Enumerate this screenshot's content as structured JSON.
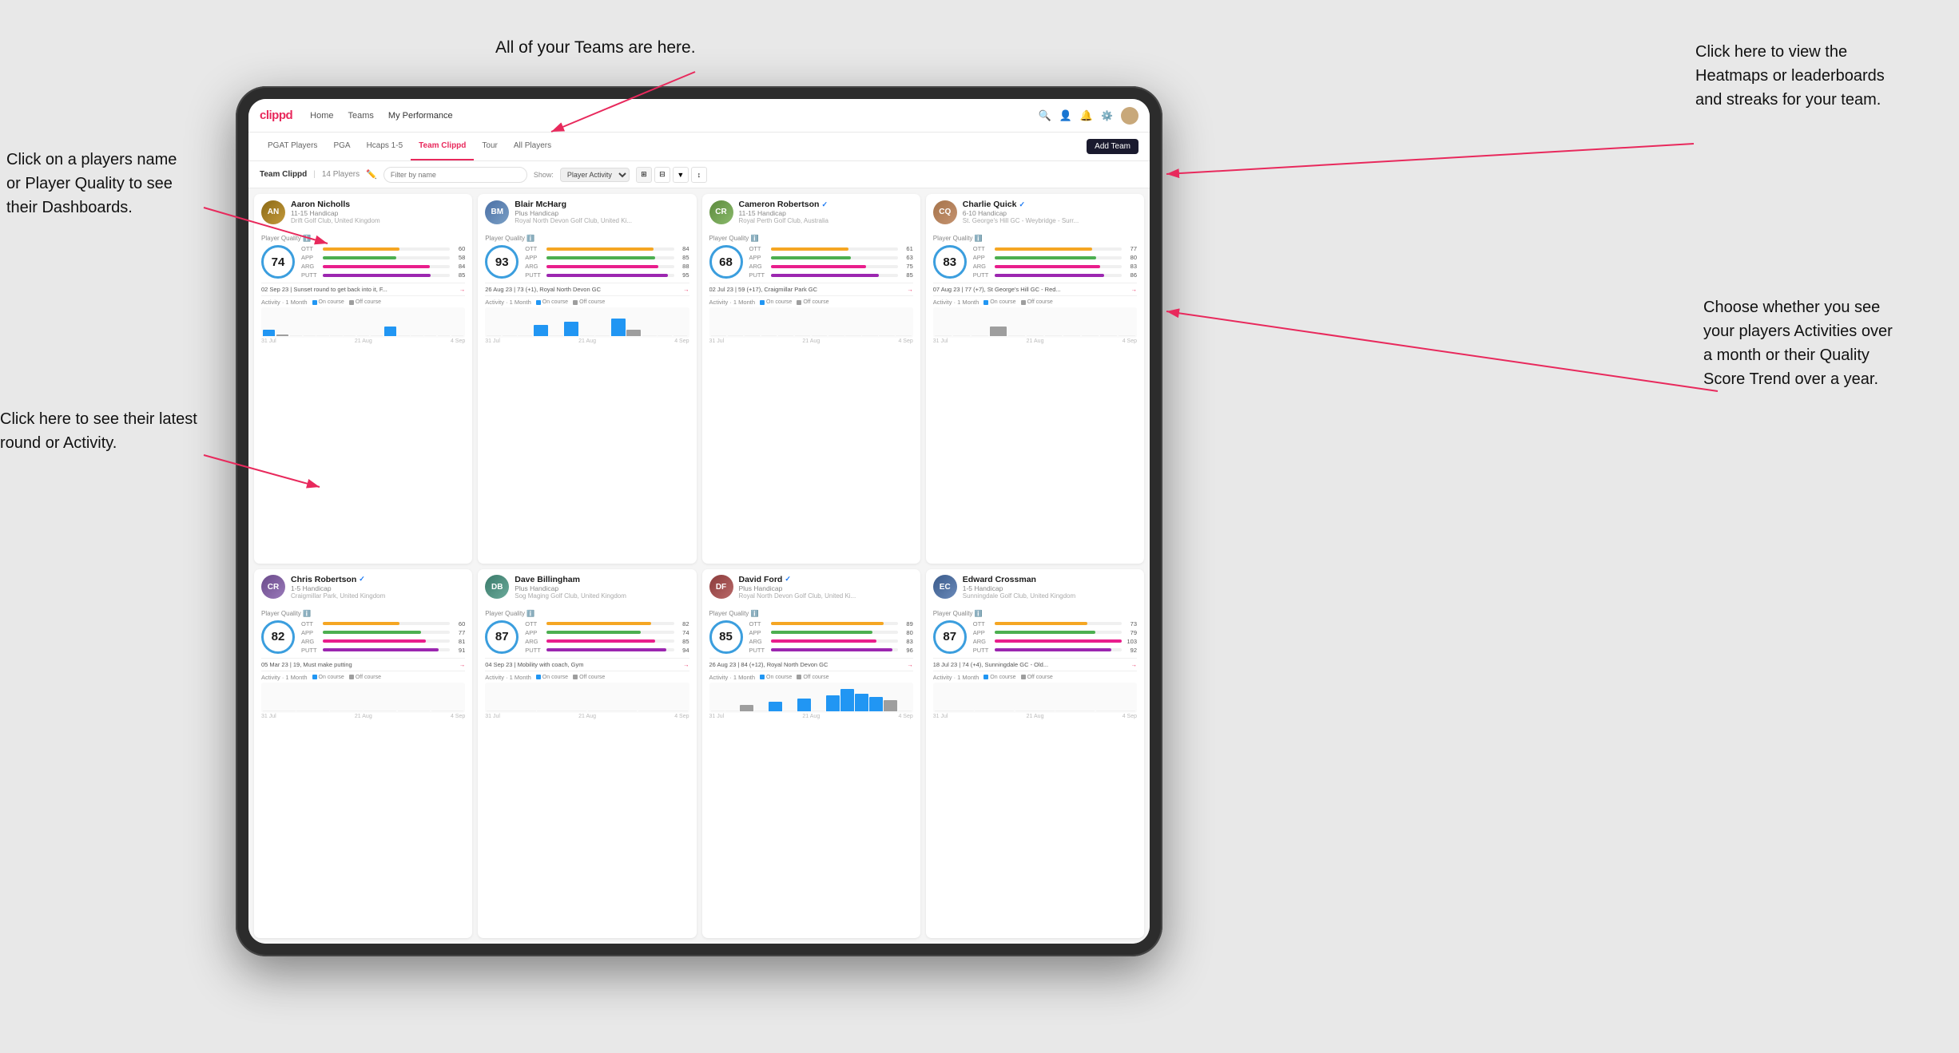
{
  "annotations": {
    "top_arrow": "All of your Teams are here.",
    "right_top": "Click here to view the\nHeatmaps or leaderboards\nand streaks for your team.",
    "left_top": "Click on a players name\nor Player Quality to see\ntheir Dashboards.",
    "left_bottom": "Click here to see their latest\nround or Activity.",
    "right_bottom": "Choose whether you see\nyour players Activities over\na month or their Quality\nScore Trend over a year."
  },
  "navbar": {
    "logo": "clippd",
    "links": [
      "Home",
      "Teams",
      "My Performance"
    ],
    "active_link": "My Performance"
  },
  "subnav": {
    "tabs": [
      "PGAT Players",
      "PGA",
      "Hcaps 1-5",
      "Team Clippd",
      "Tour",
      "All Players"
    ],
    "active_tab": "Team Clippd",
    "add_team": "Add Team"
  },
  "team_header": {
    "title": "Team Clippd",
    "count": "14 Players",
    "filter_placeholder": "Filter by name",
    "show_label": "Show:",
    "show_option": "Player Activity"
  },
  "players": [
    {
      "id": 1,
      "name": "Aaron Nicholls",
      "handicap": "11-15 Handicap",
      "club": "Drift Golf Club, United Kingdom",
      "quality": 74,
      "ott": {
        "value": 60,
        "pct": 60
      },
      "app": {
        "value": 58,
        "pct": 58
      },
      "arg": {
        "value": 84,
        "pct": 84
      },
      "putt": {
        "value": 85,
        "pct": 85
      },
      "latest_round": "02 Sep 23 | Sunset round to get back into it, F...",
      "activity_bars": [
        0,
        0,
        0,
        0,
        0,
        0,
        0,
        0,
        0,
        0,
        0,
        0,
        0,
        0,
        2,
        0,
        3,
        0,
        0,
        0,
        0,
        0,
        0,
        0,
        0,
        0,
        0,
        0
      ],
      "dates": [
        "31 Jul",
        "21 Aug",
        "4 Sep"
      ],
      "verified": false
    },
    {
      "id": 2,
      "name": "Blair McHarg",
      "handicap": "Plus Handicap",
      "club": "Royal North Devon Golf Club, United Ki...",
      "quality": 93,
      "ott": {
        "value": 84,
        "pct": 84
      },
      "app": {
        "value": 85,
        "pct": 85
      },
      "arg": {
        "value": 88,
        "pct": 88
      },
      "putt": {
        "value": 95,
        "pct": 95
      },
      "latest_round": "26 Aug 23 | 73 (+1), Royal North Devon GC",
      "activity_bars": [
        0,
        0,
        0,
        0,
        0,
        0,
        0,
        3,
        0,
        0,
        0,
        4,
        0,
        0,
        5,
        0,
        0,
        3,
        0,
        0,
        0,
        4,
        0,
        0,
        0,
        0,
        0,
        0
      ],
      "dates": [
        "31 Jul",
        "21 Aug",
        "4 Sep"
      ],
      "verified": false
    },
    {
      "id": 3,
      "name": "Cameron Robertson",
      "handicap": "11-15 Handicap",
      "club": "Royal Perth Golf Club, Australia",
      "quality": 68,
      "ott": {
        "value": 61,
        "pct": 61
      },
      "app": {
        "value": 63,
        "pct": 63
      },
      "arg": {
        "value": 75,
        "pct": 75
      },
      "putt": {
        "value": 85,
        "pct": 85
      },
      "latest_round": "02 Jul 23 | 59 (+17), Craigmillar Park GC",
      "activity_bars": [
        0,
        0,
        0,
        0,
        0,
        0,
        0,
        0,
        0,
        0,
        0,
        0,
        0,
        0,
        0,
        0,
        0,
        0,
        0,
        0,
        0,
        0,
        0,
        0,
        0,
        0,
        0,
        0
      ],
      "dates": [
        "31 Jul",
        "21 Aug",
        "4 Sep"
      ],
      "verified": true
    },
    {
      "id": 4,
      "name": "Charlie Quick",
      "handicap": "6-10 Handicap",
      "club": "St. George's Hill GC - Weybridge - Surr...",
      "quality": 83,
      "ott": {
        "value": 77,
        "pct": 77
      },
      "app": {
        "value": 80,
        "pct": 80
      },
      "arg": {
        "value": 83,
        "pct": 83
      },
      "putt": {
        "value": 86,
        "pct": 86
      },
      "latest_round": "07 Aug 23 | 77 (+7), St George's Hill GC - Red...",
      "activity_bars": [
        0,
        0,
        0,
        0,
        0,
        0,
        0,
        0,
        0,
        0,
        0,
        3,
        0,
        0,
        0,
        0,
        0,
        0,
        0,
        0,
        0,
        0,
        0,
        0,
        0,
        0,
        0,
        0
      ],
      "dates": [
        "31 Jul",
        "21 Aug",
        "4 Sep"
      ],
      "verified": true
    },
    {
      "id": 5,
      "name": "Chris Robertson",
      "handicap": "1-5 Handicap",
      "club": "Craigmillar Park, United Kingdom",
      "quality": 82,
      "ott": {
        "value": 60,
        "pct": 60
      },
      "app": {
        "value": 77,
        "pct": 77
      },
      "arg": {
        "value": 81,
        "pct": 81
      },
      "putt": {
        "value": 91,
        "pct": 91
      },
      "latest_round": "05 Mar 23 | 19, Must make putting",
      "activity_bars": [
        0,
        0,
        0,
        0,
        0,
        0,
        0,
        0,
        0,
        0,
        0,
        0,
        0,
        0,
        0,
        0,
        0,
        0,
        0,
        0,
        0,
        0,
        0,
        0,
        0,
        0,
        0,
        0
      ],
      "dates": [
        "31 Jul",
        "21 Aug",
        "4 Sep"
      ],
      "verified": true
    },
    {
      "id": 6,
      "name": "Dave Billingham",
      "handicap": "Plus Handicap",
      "club": "Sog Maging Golf Club, United Kingdom",
      "quality": 87,
      "ott": {
        "value": 82,
        "pct": 82
      },
      "app": {
        "value": 74,
        "pct": 74
      },
      "arg": {
        "value": 85,
        "pct": 85
      },
      "putt": {
        "value": 94,
        "pct": 94
      },
      "latest_round": "04 Sep 23 | Mobility with coach, Gym",
      "activity_bars": [
        0,
        0,
        0,
        0,
        0,
        0,
        0,
        0,
        0,
        0,
        0,
        0,
        0,
        0,
        0,
        0,
        0,
        0,
        0,
        0,
        0,
        0,
        0,
        0,
        0,
        0,
        0,
        0
      ],
      "dates": [
        "31 Jul",
        "21 Aug",
        "4 Sep"
      ],
      "verified": false
    },
    {
      "id": 7,
      "name": "David Ford",
      "handicap": "Plus Handicap",
      "club": "Royal North Devon Golf Club, United Ki...",
      "quality": 85,
      "ott": {
        "value": 89,
        "pct": 89
      },
      "app": {
        "value": 80,
        "pct": 80
      },
      "arg": {
        "value": 83,
        "pct": 83
      },
      "putt": {
        "value": 96,
        "pct": 96
      },
      "latest_round": "26 Aug 23 | 84 (+12), Royal North Devon GC",
      "activity_bars": [
        0,
        0,
        0,
        0,
        0,
        0,
        0,
        0,
        3,
        0,
        4,
        0,
        5,
        0,
        6,
        0,
        4,
        0,
        3,
        4,
        5,
        6,
        7,
        6,
        5,
        0,
        0,
        0
      ],
      "dates": [
        "31 Jul",
        "21 Aug",
        "4 Sep"
      ],
      "verified": true
    },
    {
      "id": 8,
      "name": "Edward Crossman",
      "handicap": "1-5 Handicap",
      "club": "Sunningdale Golf Club, United Kingdom",
      "quality": 87,
      "ott": {
        "value": 73,
        "pct": 73
      },
      "app": {
        "value": 79,
        "pct": 79
      },
      "arg": {
        "value": 103,
        "pct": 100
      },
      "putt": {
        "value": 92,
        "pct": 92
      },
      "latest_round": "18 Jul 23 | 74 (+4), Sunningdale GC - Old...",
      "activity_bars": [
        0,
        0,
        0,
        0,
        0,
        0,
        0,
        0,
        0,
        0,
        0,
        0,
        0,
        0,
        0,
        0,
        0,
        0,
        0,
        0,
        0,
        0,
        0,
        0,
        0,
        0,
        0,
        0
      ],
      "dates": [
        "31 Jul",
        "21 Aug",
        "4 Sep"
      ],
      "verified": false
    }
  ]
}
